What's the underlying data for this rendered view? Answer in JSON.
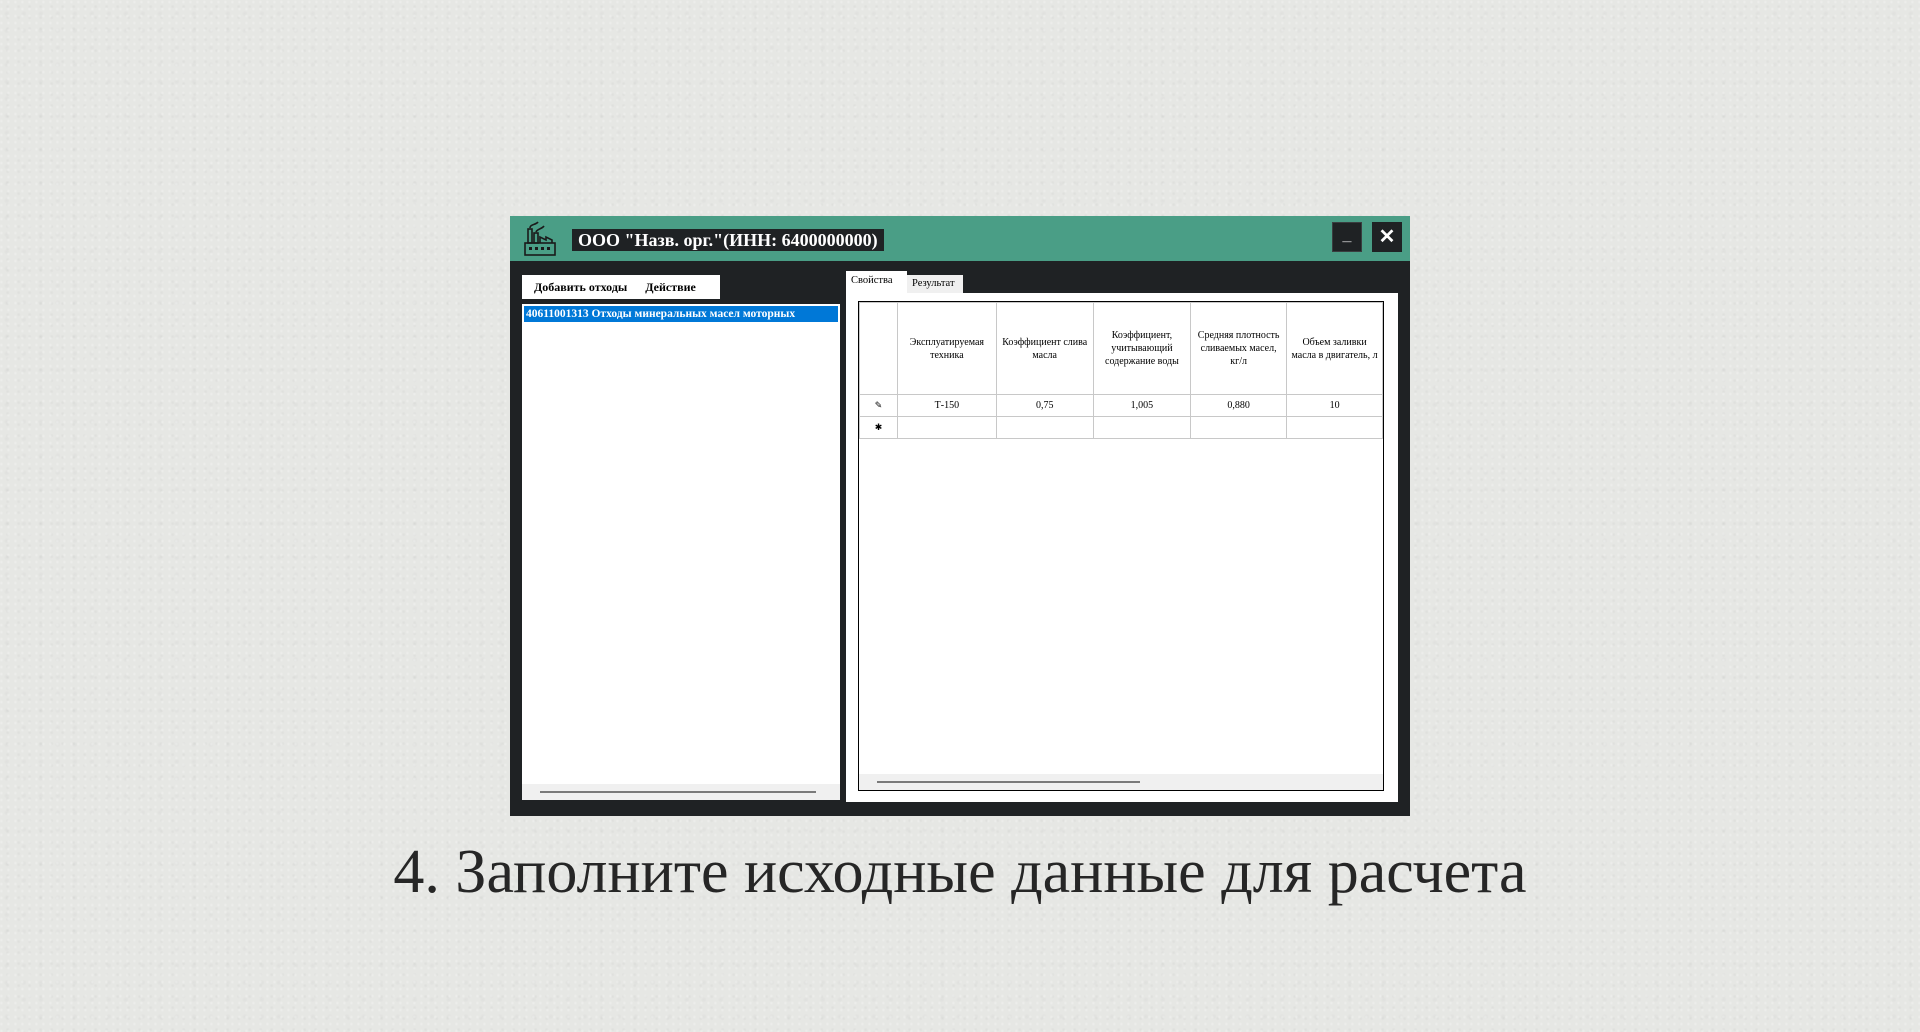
{
  "window": {
    "title": "ООО \"Назв. орг.\"(ИНН: 6400000000)",
    "minimize_label": "_",
    "close_label": "✕",
    "icon": "factory-icon",
    "colors": {
      "titlebar": "#4a9e86",
      "frame": "#1f2224",
      "selection": "#0078d7"
    }
  },
  "left": {
    "toolbar": {
      "add_label": "Добавить отходы",
      "action_label": "Действие"
    },
    "items": [
      {
        "label": "40611001313 Отходы минеральных масел моторных"
      }
    ]
  },
  "right": {
    "tabs": [
      {
        "label": "Свойства",
        "active": true
      },
      {
        "label": "Результат",
        "active": false
      }
    ],
    "columns": [
      "Эксплуатируемая техника",
      "Коэффициент слива масла",
      "Коэффициент, учитывающий содержание воды",
      "Средняя плотность сливаемых масел, кг/л",
      "Объем заливки масла в двигатель, л"
    ],
    "rows": [
      {
        "marker": "pencil-icon",
        "marker_text": "✎",
        "cells": [
          "Т-150",
          "0,75",
          "1,005",
          "0,880",
          "10"
        ]
      },
      {
        "marker": "new-row-icon",
        "marker_text": "✱",
        "cells": [
          "",
          "",
          "",
          "",
          ""
        ]
      }
    ]
  },
  "caption": "4. Заполните исходные данные для расчета"
}
